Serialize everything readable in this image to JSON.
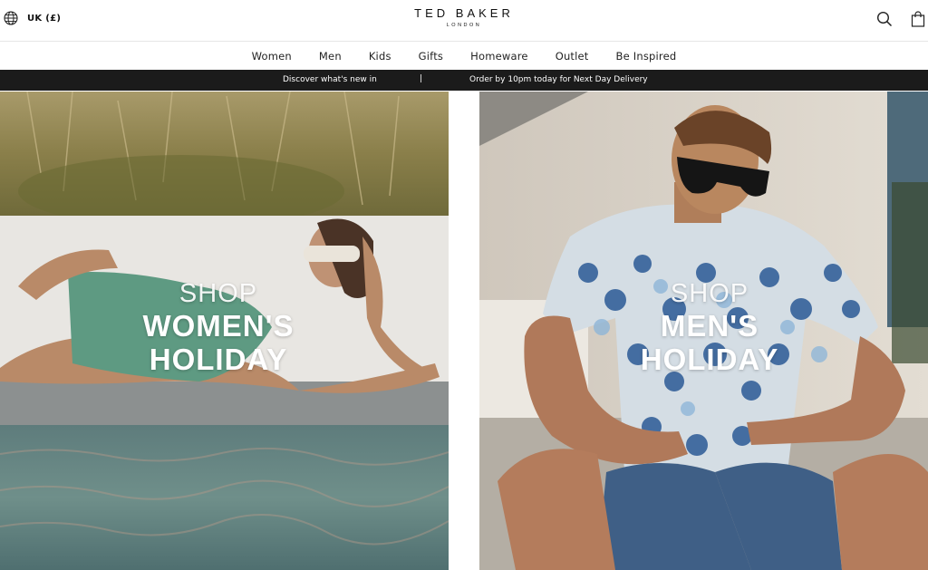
{
  "header": {
    "region_label": "UK (£)",
    "region_icon": "globe-icon",
    "logo_main": "TED BAKER",
    "logo_sub": "LONDON",
    "search_icon": "search-icon",
    "bag_icon": "shopping-bag-icon"
  },
  "nav": {
    "items": [
      "Women",
      "Men",
      "Kids",
      "Gifts",
      "Homeware",
      "Outlet",
      "Be Inspired"
    ]
  },
  "promo": {
    "left": "Discover what's new in",
    "separator": "|",
    "right": "Order by 10pm today for Next Day Delivery",
    "background": "#1b1b1b"
  },
  "hero": {
    "women": {
      "shop": "SHOP",
      "line1": "WOMEN'S",
      "line2": "HOLIDAY"
    },
    "men": {
      "shop": "SHOP",
      "line1": "MEN'S",
      "line2": "HOLIDAY"
    }
  }
}
